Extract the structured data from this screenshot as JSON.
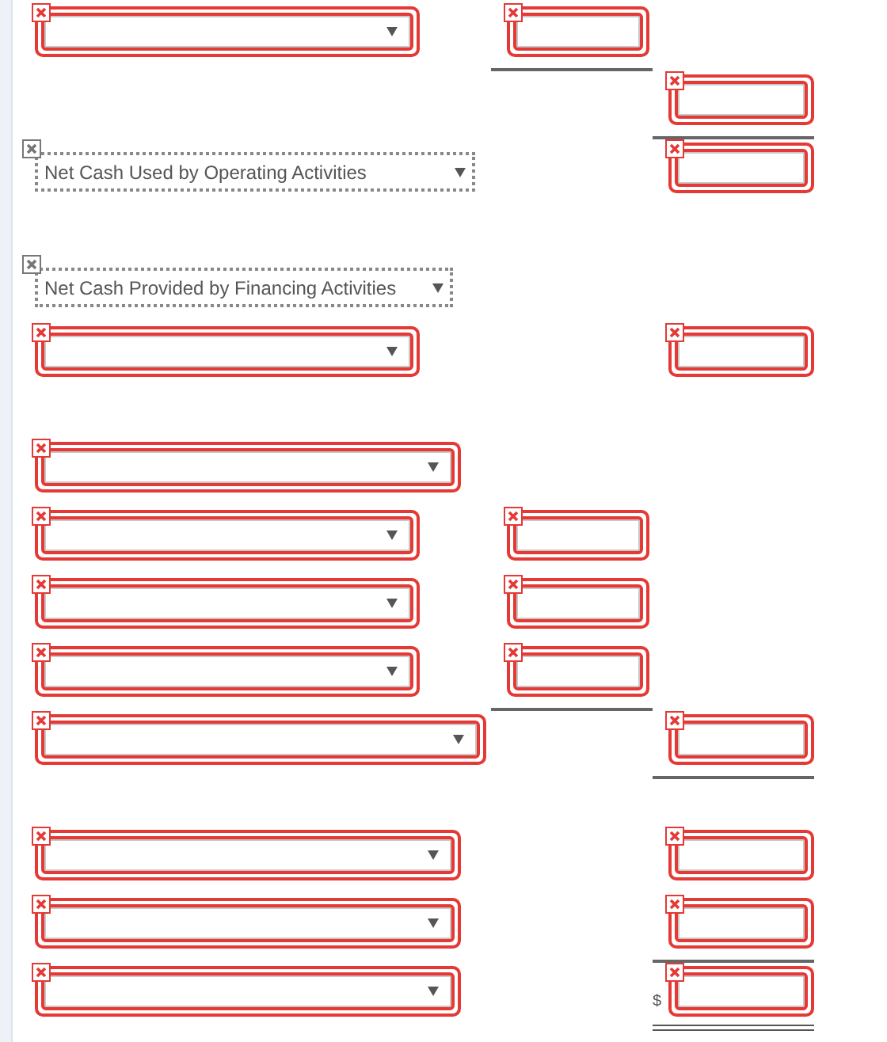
{
  "sections": [
    {
      "rows": [
        {
          "select": {
            "invalid": true
          },
          "mid": {
            "invalid": true,
            "underlined": true
          }
        },
        {
          "right": {
            "invalid": true,
            "underlined": true
          }
        },
        {
          "select": {
            "invalid": false,
            "value": "Net Cash Used by Operating Activities"
          },
          "right": {
            "invalid": true
          }
        }
      ]
    },
    {
      "rows": [
        {
          "select": {
            "invalid": false,
            "value": "Net Cash Provided by Financing Activities"
          }
        },
        {
          "select": {
            "invalid": true
          },
          "right": {
            "invalid": true
          }
        }
      ]
    },
    {
      "rows": [
        {
          "select": {
            "invalid": true
          }
        },
        {
          "select": {
            "invalid": true
          },
          "mid": {
            "invalid": true
          }
        },
        {
          "select": {
            "invalid": true
          },
          "mid": {
            "invalid": true
          }
        },
        {
          "select": {
            "invalid": true
          },
          "mid": {
            "invalid": true,
            "underlined": true
          }
        },
        {
          "select": {
            "invalid": true
          },
          "right": {
            "invalid": true,
            "underlined": true
          }
        }
      ]
    },
    {
      "rows": [
        {
          "select": {
            "invalid": true
          },
          "right": {
            "invalid": true
          }
        },
        {
          "select": {
            "invalid": true
          },
          "right": {
            "invalid": true,
            "underlined": true
          }
        },
        {
          "select": {
            "invalid": true
          },
          "right": {
            "invalid": true,
            "prefix": "$",
            "double_underlined": true
          }
        }
      ]
    }
  ]
}
